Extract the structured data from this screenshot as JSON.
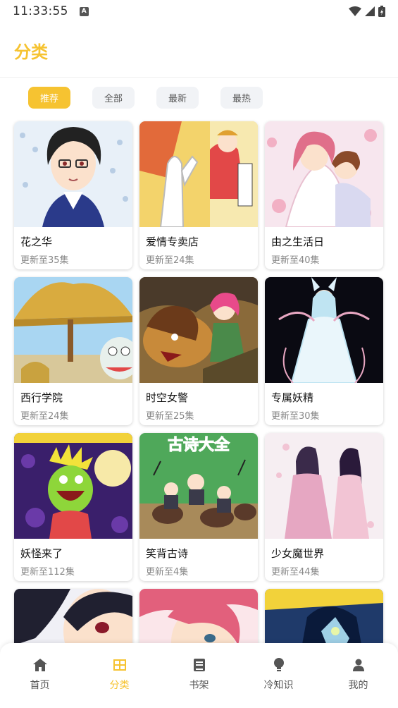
{
  "status_bar": {
    "time": "11:33:55",
    "notif_letter": "A"
  },
  "header": {
    "title": "分类"
  },
  "filters": [
    {
      "label": "推荐",
      "active": true
    },
    {
      "label": "全部",
      "active": false
    },
    {
      "label": "最新",
      "active": false
    },
    {
      "label": "最热",
      "active": false
    }
  ],
  "comics": [
    {
      "title": "花之华",
      "update": "更新至35集",
      "cover_colors": [
        "#e8f0f8",
        "#2a3a8a"
      ]
    },
    {
      "title": "爱情专卖店",
      "update": "更新至24集",
      "cover_colors": [
        "#f3d36b",
        "#e26a3a"
      ]
    },
    {
      "title": "由之生活日",
      "update": "更新至40集",
      "cover_colors": [
        "#f7e6ee",
        "#e06f8a"
      ]
    },
    {
      "title": "西行学院",
      "update": "更新至24集",
      "cover_colors": [
        "#a9d6f2",
        "#c9a23f"
      ]
    },
    {
      "title": "时空女警",
      "update": "更新至25集",
      "cover_colors": [
        "#6b4a2a",
        "#c88a3a"
      ]
    },
    {
      "title": "专属妖精",
      "update": "更新至30集",
      "cover_colors": [
        "#0a0a12",
        "#bfe4f2"
      ]
    },
    {
      "title": "妖怪来了",
      "update": "更新至112集",
      "cover_colors": [
        "#3a1f6b",
        "#8ed63a"
      ]
    },
    {
      "title": "笑背古诗",
      "update": "更新至4集",
      "cover_colors": [
        "#4fa85a",
        "#e6e0c8"
      ]
    },
    {
      "title": "少女魔世界",
      "update": "更新至44集",
      "cover_colors": [
        "#f6eef2",
        "#e6a7c2"
      ]
    },
    {
      "title": "",
      "update": "",
      "cover_colors": [
        "#f0f0f6",
        "#202030"
      ]
    },
    {
      "title": "",
      "update": "",
      "cover_colors": [
        "#fbe6ea",
        "#e2607c"
      ]
    },
    {
      "title": "",
      "update": "",
      "cover_colors": [
        "#1f3a6a",
        "#9fd0e6"
      ]
    }
  ],
  "cover_text": {
    "comic_8": "古诗大全"
  },
  "bottom_nav": [
    {
      "label": "首页",
      "icon": "home-icon",
      "active": false
    },
    {
      "label": "分类",
      "icon": "grid-icon",
      "active": true
    },
    {
      "label": "书架",
      "icon": "book-icon",
      "active": false
    },
    {
      "label": "冷知识",
      "icon": "lightbulb-icon",
      "active": false
    },
    {
      "label": "我的",
      "icon": "person-icon",
      "active": false
    }
  ],
  "colors": {
    "accent": "#f6c331",
    "nav_inactive": "#555555",
    "muted_text": "#888888"
  }
}
